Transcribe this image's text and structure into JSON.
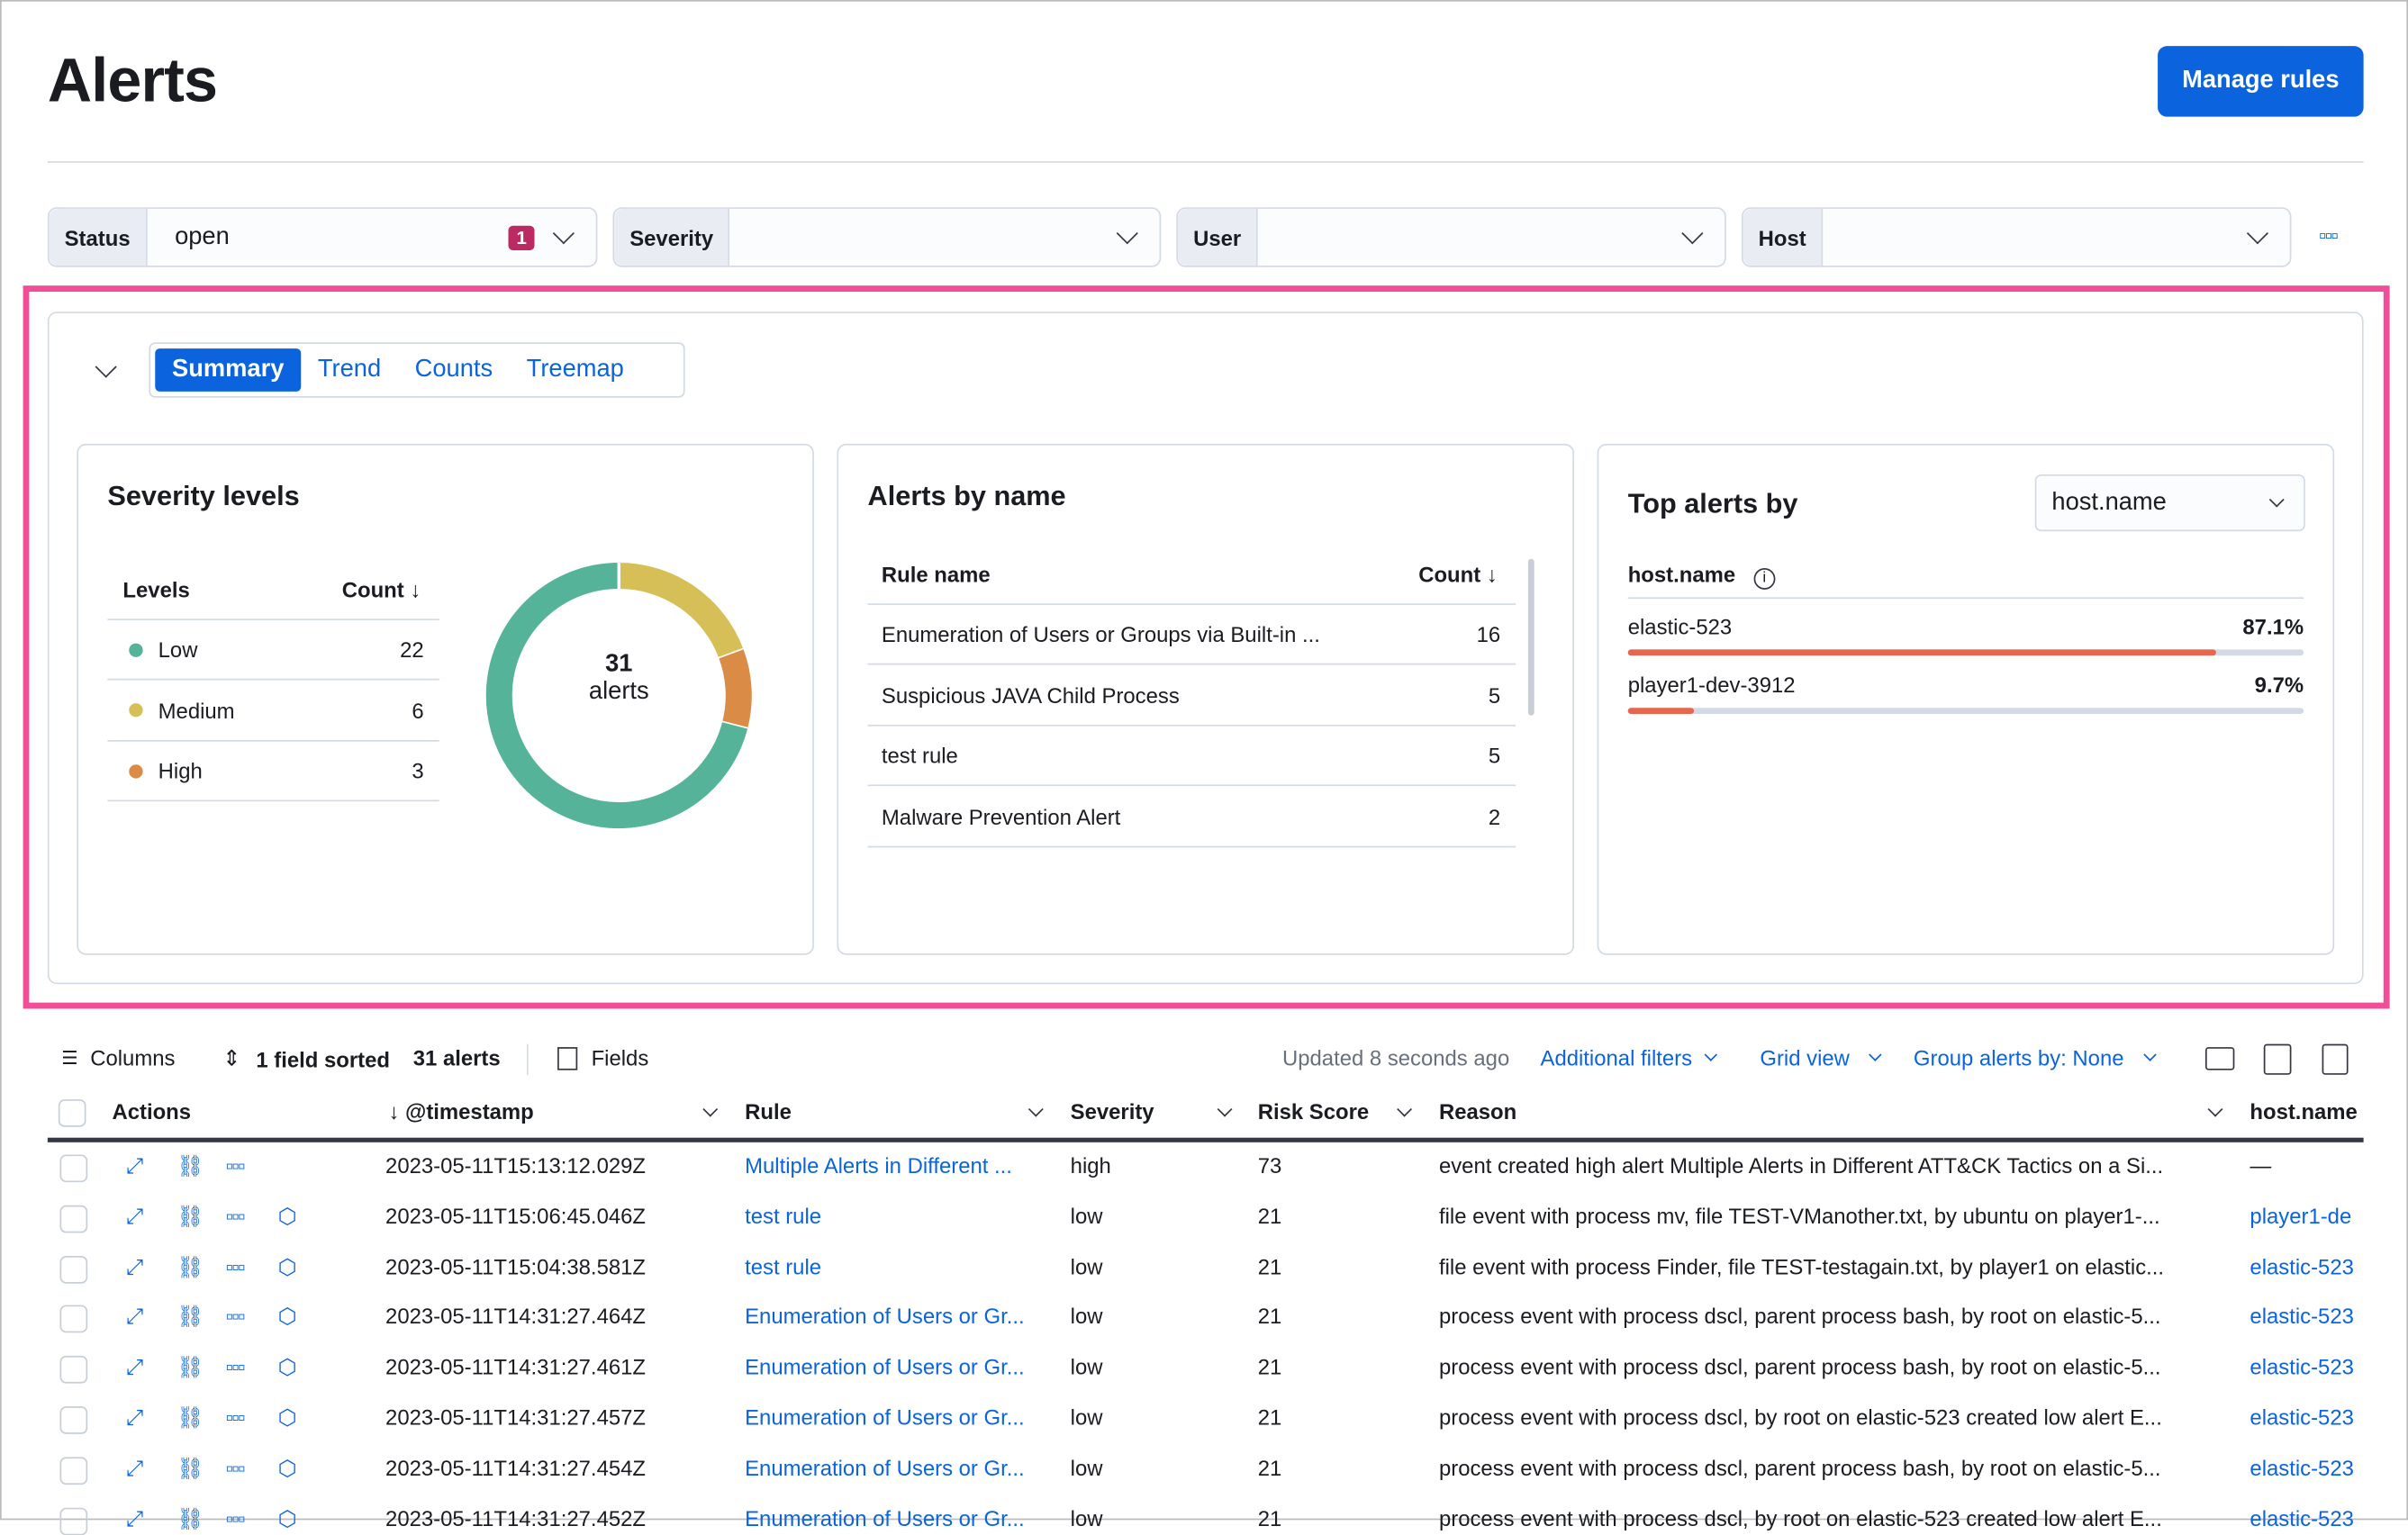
{
  "header": {
    "title": "Alerts",
    "manage_rules": "Manage rules"
  },
  "filters": [
    {
      "label": "Status",
      "value": "open",
      "badge": "1"
    },
    {
      "label": "Severity",
      "value": ""
    },
    {
      "label": "User",
      "value": ""
    },
    {
      "label": "Host",
      "value": ""
    }
  ],
  "tabs": [
    "Summary",
    "Trend",
    "Counts",
    "Treemap"
  ],
  "severity": {
    "title": "Severity levels",
    "col_levels": "Levels",
    "col_count": "Count",
    "rows": [
      {
        "label": "Low",
        "count": "22",
        "color": "#54b399"
      },
      {
        "label": "Medium",
        "count": "6",
        "color": "#d6bf57"
      },
      {
        "label": "High",
        "count": "3",
        "color": "#da8b45"
      }
    ],
    "total": "31",
    "total_label": "alerts"
  },
  "by_name": {
    "title": "Alerts by name",
    "col_rule": "Rule name",
    "col_count": "Count",
    "rows": [
      {
        "name": "Enumeration of Users or Groups via Built-in ...",
        "count": "16"
      },
      {
        "name": "Suspicious JAVA Child Process",
        "count": "5"
      },
      {
        "name": "test rule",
        "count": "5"
      },
      {
        "name": "Malware Prevention Alert",
        "count": "2"
      }
    ]
  },
  "top_alerts": {
    "title": "Top alerts by",
    "select": "host.name",
    "field": "host.name",
    "rows": [
      {
        "name": "elastic-523",
        "pct": "87.1%",
        "value": 87.1
      },
      {
        "name": "player1-dev-3912",
        "pct": "9.7%",
        "value": 9.7
      }
    ],
    "bar_color": "#e7664c"
  },
  "toolbar": {
    "columns": "Columns",
    "sorted": "1 field sorted",
    "count": "31 alerts",
    "fields": "Fields",
    "updated": "Updated 8 seconds ago",
    "additional_filters": "Additional filters",
    "grid_view": "Grid view",
    "group_by": "Group alerts by: None"
  },
  "table": {
    "headers": [
      "Actions",
      "@timestamp",
      "Rule",
      "Severity",
      "Risk Score",
      "Reason",
      "host.name"
    ],
    "rows": [
      [
        "2023-05-11T15:13:12.029Z",
        "Multiple Alerts in Different ...",
        "high",
        "73",
        "event created high alert Multiple Alerts in Different ATT&CK Tactics on a Si...",
        "—"
      ],
      [
        "2023-05-11T15:06:45.046Z",
        "test rule",
        "low",
        "21",
        "file event with process mv, file TEST-VManother.txt, by ubuntu on player1-...",
        "player1-de"
      ],
      [
        "2023-05-11T15:04:38.581Z",
        "test rule",
        "low",
        "21",
        "file event with process Finder, file TEST-testagain.txt, by player1 on elastic...",
        "elastic-523"
      ],
      [
        "2023-05-11T14:31:27.464Z",
        "Enumeration of Users or Gr...",
        "low",
        "21",
        "process event with process dscl, parent process bash, by root on elastic-5...",
        "elastic-523"
      ],
      [
        "2023-05-11T14:31:27.461Z",
        "Enumeration of Users or Gr...",
        "low",
        "21",
        "process event with process dscl, parent process bash, by root on elastic-5...",
        "elastic-523"
      ],
      [
        "2023-05-11T14:31:27.457Z",
        "Enumeration of Users or Gr...",
        "low",
        "21",
        "process event with process dscl, by root on elastic-523 created low alert E...",
        "elastic-523"
      ],
      [
        "2023-05-11T14:31:27.454Z",
        "Enumeration of Users or Gr...",
        "low",
        "21",
        "process event with process dscl, parent process bash, by root on elastic-5...",
        "elastic-523"
      ],
      [
        "2023-05-11T14:31:27.452Z",
        "Enumeration of Users or Gr...",
        "low",
        "21",
        "process event with process dscl, by root on elastic-523 created low alert E...",
        "elastic-523"
      ]
    ]
  }
}
